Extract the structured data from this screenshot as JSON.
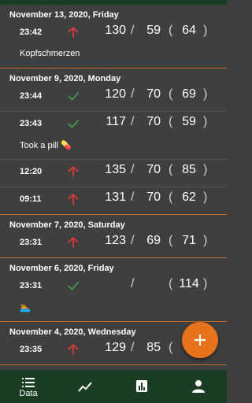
{
  "colors": {
    "background": "#3f3f3f",
    "accent": "#e8731a",
    "nav": "#1b3d24",
    "up": "#e53935",
    "check": "#43a047"
  },
  "groups": [
    {
      "date": "November 13, 2020,  Friday",
      "entries": [
        {
          "time": "23:42",
          "trend": "up-arrow-icon",
          "sys": "130",
          "sep": "/",
          "dia": "59",
          "open": "(",
          "pulse": "64",
          "close": ")",
          "note": "Kopfschmerzen",
          "emoji_name": ""
        }
      ]
    },
    {
      "date": "November 9, 2020,  Monday",
      "entries": [
        {
          "time": "23:44",
          "trend": "check-icon",
          "sys": "120",
          "sep": "/",
          "dia": "70",
          "open": "(",
          "pulse": "69",
          "close": ")",
          "note": "",
          "emoji_name": ""
        },
        {
          "time": "23:43",
          "trend": "check-icon",
          "sys": "117",
          "sep": "/",
          "dia": "70",
          "open": "(",
          "pulse": "59",
          "close": ")",
          "note": "Took a pill ",
          "emoji": "💊",
          "emoji_name": "pill-emoji"
        },
        {
          "time": "12:20",
          "trend": "up-arrow-icon",
          "sys": "135",
          "sep": "/",
          "dia": "70",
          "open": "(",
          "pulse": "85",
          "close": ")",
          "note": "",
          "emoji_name": ""
        },
        {
          "time": "09:11",
          "trend": "up-arrow-icon",
          "sys": "131",
          "sep": "/",
          "dia": "70",
          "open": "(",
          "pulse": "62",
          "close": ")",
          "note": "",
          "emoji_name": ""
        }
      ]
    },
    {
      "date": "November 7, 2020,  Saturday",
      "entries": [
        {
          "time": "23:31",
          "trend": "up-arrow-icon",
          "sys": "123",
          "sep": "/",
          "dia": "69",
          "open": "(",
          "pulse": "71",
          "close": ")",
          "note": "",
          "emoji_name": ""
        }
      ]
    },
    {
      "date": "November 6, 2020,  Friday",
      "entries": [
        {
          "time": "23:31",
          "trend": "check-icon",
          "sys": "",
          "sep": "/",
          "dia": "",
          "open": "(",
          "pulse": "114",
          "close": ")",
          "note": "",
          "emoji": "🏊",
          "emoji_name": "swimmer-emoji"
        }
      ]
    },
    {
      "date": "November 4, 2020,  Wednesday",
      "entries": [
        {
          "time": "23:35",
          "trend": "up-arrow-icon",
          "sys": "129",
          "sep": "/",
          "dia": "85",
          "open": "(",
          "pulse": "",
          "close": "",
          "note": "",
          "emoji_name": ""
        }
      ]
    }
  ],
  "fab": {
    "icon": "plus-icon"
  },
  "nav": [
    {
      "id": "data",
      "label": "Data",
      "icon": "list-icon"
    },
    {
      "id": "trend",
      "label": "",
      "icon": "trend-line-icon"
    },
    {
      "id": "stats",
      "label": "",
      "icon": "bar-chart-icon"
    },
    {
      "id": "profile",
      "label": "",
      "icon": "person-icon"
    }
  ]
}
